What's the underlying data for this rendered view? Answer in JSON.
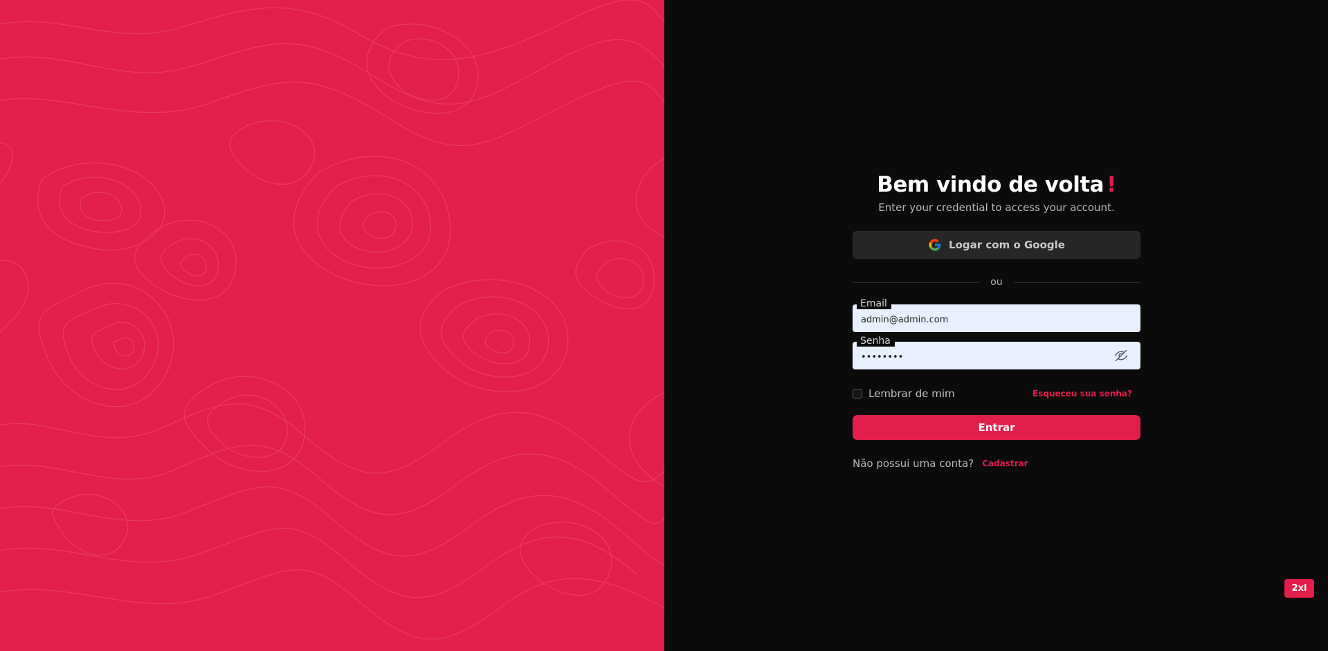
{
  "colors": {
    "accent": "#e21e4a",
    "background_dark": "#0b0b0c",
    "input_background": "#e8f0fe"
  },
  "hero": {
    "pattern": "topographic-contour-lines"
  },
  "login": {
    "title": "Bem vindo de volta",
    "title_mark": "!",
    "subtitle": "Enter your credential to access your account.",
    "google_button_label": "Logar com o Google",
    "google_icon": "google-logo-icon",
    "divider_text": "ou",
    "email": {
      "label": "Email",
      "value": "admin@admin.com"
    },
    "password": {
      "label": "Senha",
      "value": "••••••••",
      "toggle_icon": "eye-off-icon"
    },
    "remember_label": "Lembrar de mim",
    "remember_checked": false,
    "forgot_label": "Esqueceu sua senha?",
    "submit_label": "Entrar",
    "no_account_text": "Não possui uma conta?",
    "signup_label": "Cadastrar"
  },
  "breakpoint_badge": "2xl"
}
